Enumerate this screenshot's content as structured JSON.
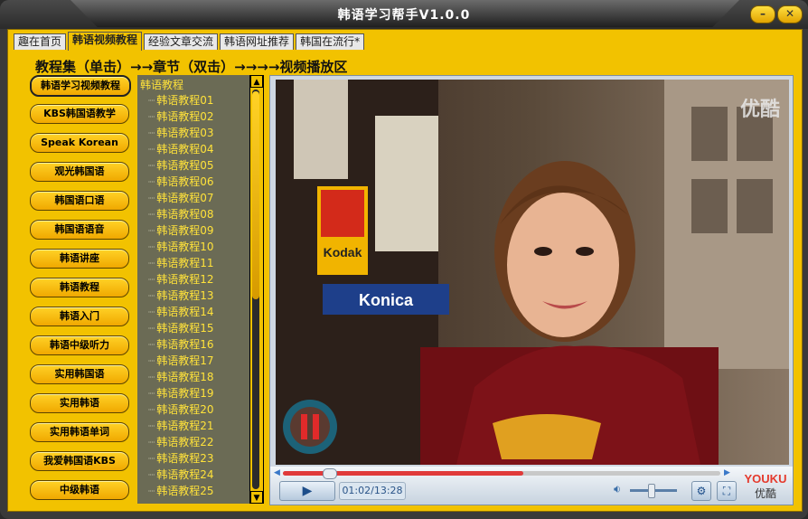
{
  "window": {
    "title": "韩语学习帮手V1.0.0",
    "minimize_label": "–",
    "close_label": "✕"
  },
  "tabs": [
    {
      "label": "趣在首页",
      "active": false
    },
    {
      "label": "韩语视频教程",
      "active": true
    },
    {
      "label": "经验文章交流",
      "active": false
    },
    {
      "label": "韩语网址推荐",
      "active": false
    },
    {
      "label": "韩国在流行*",
      "active": false
    }
  ],
  "heading": "教程集（单击）→→章节（双击）→→→→视频播放区",
  "categories": [
    "韩语学习视频教程",
    "KBS韩国语教学",
    "Speak Korean",
    "观光韩国语",
    "韩国语口语",
    "韩国语语音",
    "韩语讲座",
    "韩语教程",
    "韩语入门",
    "韩语中级听力",
    "实用韩国语",
    "实用韩语",
    "实用韩语单词",
    "我爱韩国语KBS",
    "中级韩语"
  ],
  "tree": {
    "root": "韩语教程",
    "items": [
      "韩语教程01",
      "韩语教程02",
      "韩语教程03",
      "韩语教程04",
      "韩语教程05",
      "韩语教程06",
      "韩语教程07",
      "韩语教程08",
      "韩语教程09",
      "韩语教程10",
      "韩语教程11",
      "韩语教程12",
      "韩语教程13",
      "韩语教程14",
      "韩语教程15",
      "韩语教程16",
      "韩语教程17",
      "韩语教程18",
      "韩语教程19",
      "韩语教程20",
      "韩语教程21",
      "韩语教程22",
      "韩语教程23",
      "韩语教程24",
      "韩语教程25"
    ]
  },
  "video": {
    "watermark": "优酷",
    "kodak_sign": "Kodak",
    "konica_sign": "Konica",
    "pause_icon": "pause-icon"
  },
  "controls": {
    "play_label": "▶",
    "time": "01:02/13:28",
    "progress_played": 0.55,
    "progress_knob": 0.09,
    "volume_level": 0.45,
    "settings_icon": "wrench-icon",
    "fullscreen_icon": "fullscreen-icon",
    "brand_en": "YOUKU",
    "brand_cn": "优酷"
  },
  "colors": {
    "frame": "#f2c200",
    "tree_bg": "#6b6b55",
    "tree_text": "#ffe23a",
    "progress": "#e03a3a"
  }
}
